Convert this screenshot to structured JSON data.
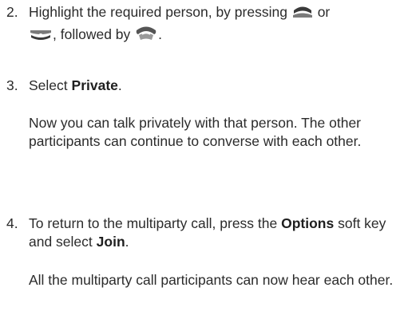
{
  "steps": [
    {
      "number": "2.",
      "part1": "Highlight the required person, by pressing",
      "or": "or",
      "part2": ", followed by",
      "end": ".",
      "icons": [
        "scroll-up-key-icon",
        "scroll-down-key-icon",
        "call-key-icon"
      ]
    },
    {
      "number": "3.",
      "prefix": "Select",
      "bold": "Private",
      "suffix": "."
    },
    {
      "number": "4.",
      "prefix": "To return to the multiparty call, press the",
      "bold1": "Options",
      "middle": "soft key and select",
      "bold2": "Join",
      "suffix": "."
    }
  ],
  "notes": {
    "private": "Now you can talk privately with that person. The other participants can continue to converse with each other.",
    "join": "All the multiparty call participants can now hear each other."
  }
}
